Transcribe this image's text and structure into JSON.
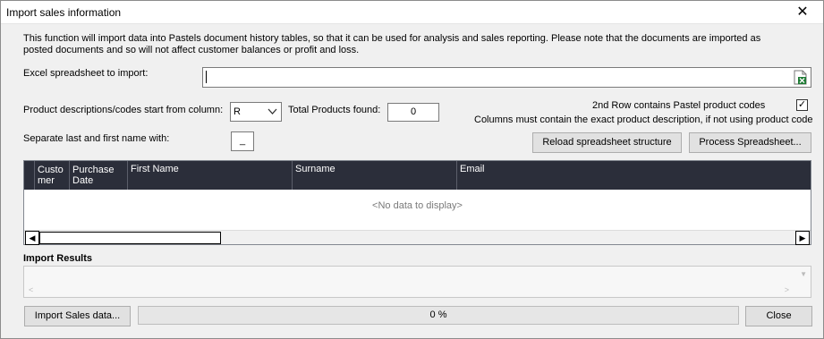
{
  "window": {
    "title": "Import sales information",
    "close_glyph": "✕"
  },
  "description": "This function will import data into Pastels document history tables, so that it can be used for analysis and sales reporting. Please note that the documents are imported as posted documents and so will not affect customer balances or profit and loss.",
  "excel": {
    "label": "Excel spreadsheet to import:",
    "value": "",
    "browse_icon": "excel-file-icon"
  },
  "column": {
    "label": "Product descriptions/codes start from column:",
    "selected": "R"
  },
  "total_products": {
    "label": "Total Products found:",
    "value": "0"
  },
  "second_row": {
    "label": "2nd Row contains Pastel product codes",
    "checked": true,
    "check_glyph": "✓"
  },
  "columns_note": "Columns must contain the exact product description, if not using product code",
  "separator": {
    "label": "Separate last and first name with:",
    "value": "_"
  },
  "buttons": {
    "reload": "Reload spreadsheet structure",
    "process": "Process Spreadsheet...",
    "import": "Import Sales data...",
    "close": "Close"
  },
  "grid": {
    "columns": [
      "Custo mer",
      "Purchase Date",
      "First Name",
      "Surname",
      "Email"
    ],
    "empty_text": "<No data to display>",
    "scroll_left": "◀",
    "scroll_right": "▶"
  },
  "results": {
    "label": "Import Results"
  },
  "progress": {
    "text": "0 %",
    "value": 0
  },
  "colors": {
    "grid_header": "#2b2e3a",
    "window_bg": "#f0f0f0",
    "button_bg": "#e1e1e1"
  }
}
